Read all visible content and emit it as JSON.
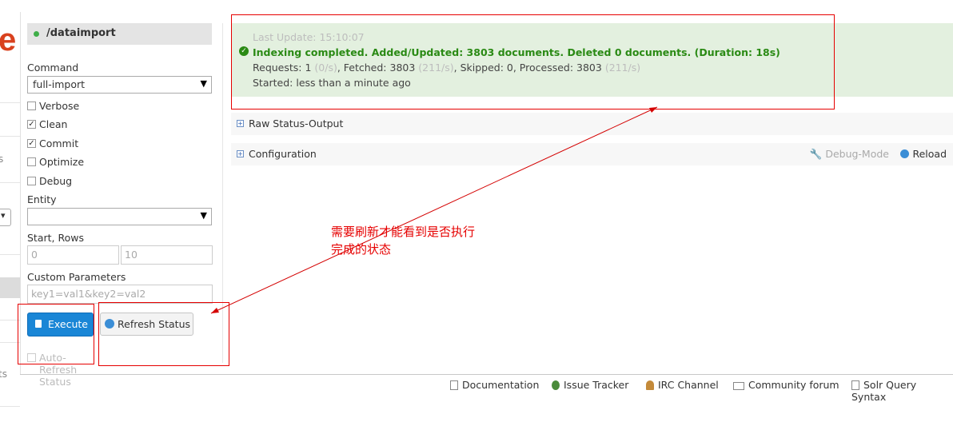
{
  "nav": {
    "logo_char": "e",
    "fragment_1": "s",
    "fragment_2": "ts"
  },
  "panel": {
    "title": "/dataimport",
    "command_label": "Command",
    "command_value": "full-import",
    "options": [
      {
        "label": "Verbose",
        "checked": false
      },
      {
        "label": "Clean",
        "checked": true
      },
      {
        "label": "Commit",
        "checked": true
      },
      {
        "label": "Optimize",
        "checked": false
      },
      {
        "label": "Debug",
        "checked": false
      }
    ],
    "entity_label": "Entity",
    "entity_value": "",
    "start_rows_label": "Start, Rows",
    "start_placeholder": "0",
    "rows_placeholder": "10",
    "custom_params_label": "Custom Parameters",
    "custom_params_placeholder": "key1=val1&key2=val2",
    "execute_label": "Execute",
    "refresh_label": "Refresh Status",
    "auto_refresh_label": "Auto-Refresh Status"
  },
  "status": {
    "last_update": "Last Update: 15:10:07",
    "headline": "Indexing completed. Added/Updated: 3803 documents. Deleted 0 documents. (Duration: 18s)",
    "req_prefix": "Requests: 1 ",
    "req_rate": "(0/s)",
    "fetched_prefix": ", Fetched: 3803 ",
    "fetched_rate": "(211/s)",
    "skipped_prefix": ", Skipped: 0, Processed: 3803 ",
    "processed_rate": "(211/s)",
    "started": "Started: less than a minute ago"
  },
  "sections": {
    "raw_label": "Raw Status-Output",
    "config_label": "Configuration",
    "debug_mode_label": "Debug-Mode",
    "reload_label": "Reload"
  },
  "annotation": {
    "line1": "需要刷新才能看到是否执行",
    "line2": "完成的状态",
    "color": "#e60000"
  },
  "footer": {
    "links": [
      "Documentation",
      "Issue Tracker",
      "IRC Channel",
      "Community forum",
      "Solr Query Syntax"
    ]
  }
}
